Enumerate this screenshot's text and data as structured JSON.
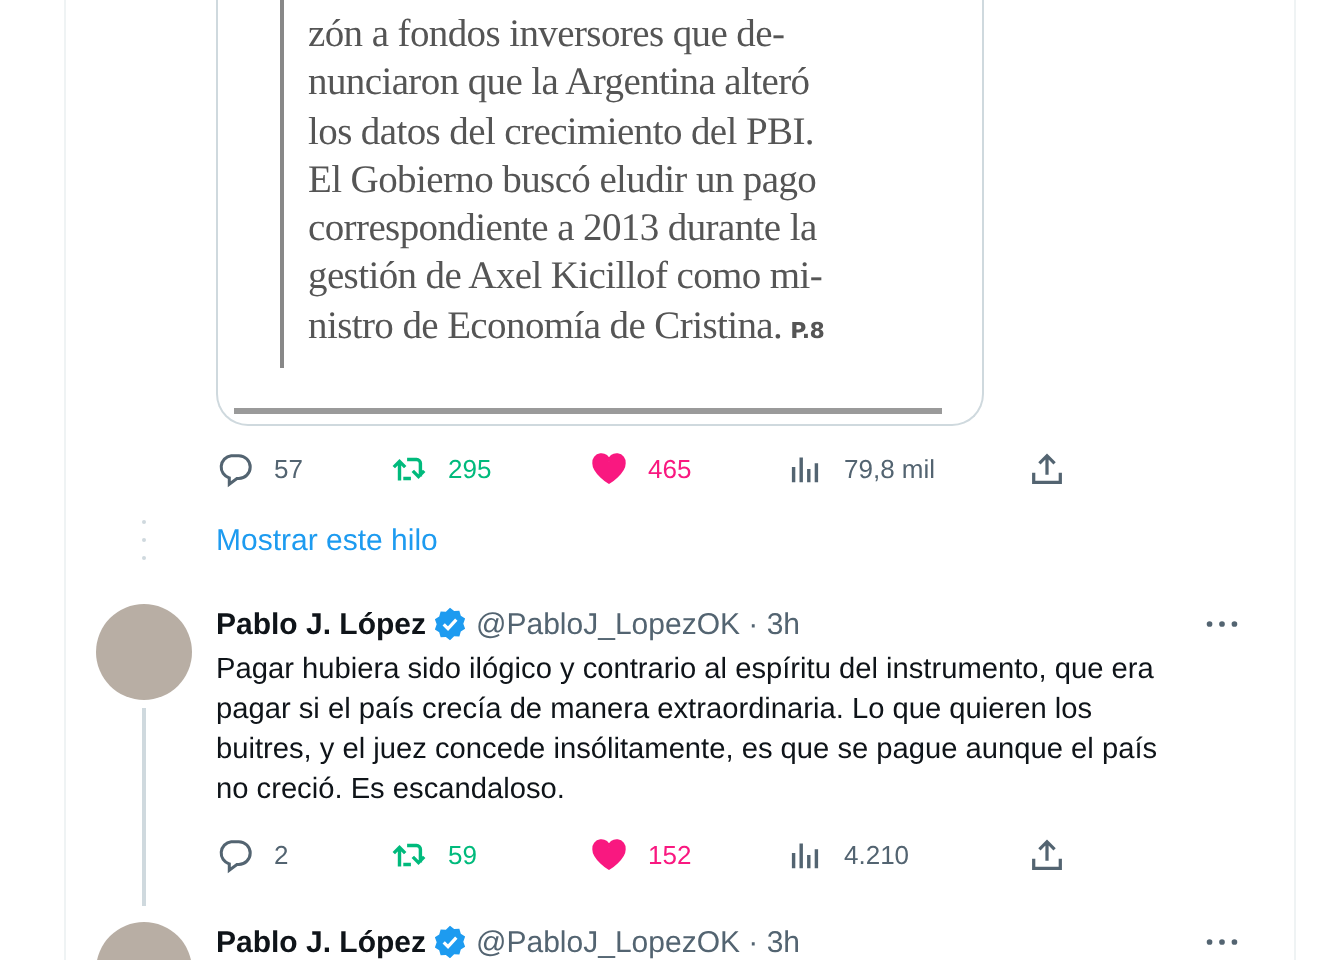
{
  "first_tweet": {
    "clipping": {
      "lines": [
        "zón a fondos inversores que de-",
        "nunciaron que la Argentina alteró",
        "los datos del crecimiento del PBI.",
        "El Gobierno buscó eludir un pago",
        "correspondiente a 2013 durante la",
        "gestión de Axel Kicillof como mi-",
        "nistro de Economía de Cristina."
      ],
      "page_ref": "P.8"
    },
    "actions": {
      "replies": "57",
      "retweets": "295",
      "retweeted": true,
      "likes": "465",
      "liked": true,
      "views": "79,8 mil"
    }
  },
  "show_thread": "Mostrar este hilo",
  "tweets": [
    {
      "name": "Pablo J. López",
      "verified": true,
      "meta": "@PabloJ_LopezOK · 3h",
      "text": "Pagar hubiera sido ilógico y contrario al espíritu del instrumento, que era pagar si el país crecía de manera extraordinaria. Lo que quieren los buitres, y el juez concede insólitamente, es que se pague aunque el país no creció. Es escandaloso.",
      "actions": {
        "replies": "2",
        "retweets": "59",
        "retweeted": true,
        "likes": "152",
        "liked": true,
        "views": "4.210"
      }
    },
    {
      "name": "Pablo J. López",
      "verified": true,
      "meta": "@PabloJ_LopezOK · 3h"
    }
  ]
}
